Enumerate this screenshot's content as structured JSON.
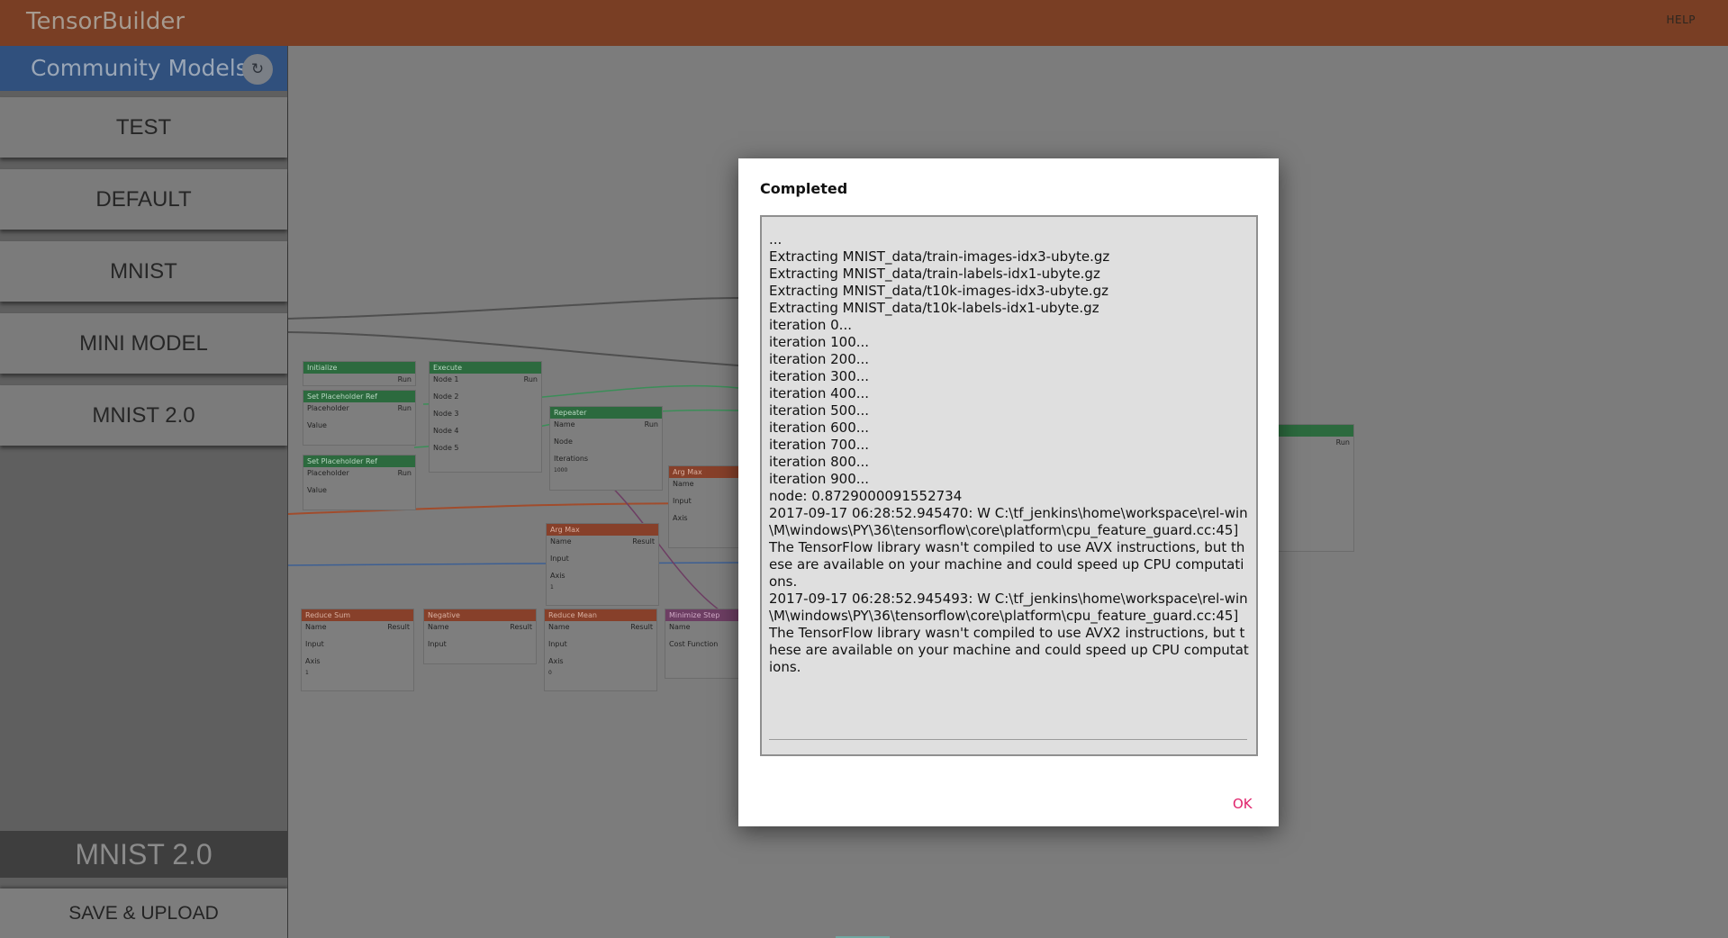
{
  "app": {
    "title": "TensorBuilder",
    "help_label": "HELP"
  },
  "sidebar": {
    "title": "Community Models",
    "refresh_icon": "↻",
    "models": [
      "TEST",
      "DEFAULT",
      "MNIST",
      "MINI MODEL",
      "MNIST 2.0"
    ],
    "current_model": "MNIST 2.0",
    "save_label": "SAVE & UPLOAD"
  },
  "canvas": {
    "nodes": {
      "initialize": {
        "title": "Initialize",
        "run": "Run"
      },
      "set_ph_1": {
        "title": "Set Placeholder Ref",
        "placeholder": "Placeholder",
        "run": "Run",
        "value": "Value"
      },
      "set_ph_2": {
        "title": "Set Placeholder Ref",
        "placeholder": "Placeholder",
        "run": "Run",
        "value": "Value"
      },
      "execute": {
        "title": "Execute",
        "run": "Run",
        "node1": "Node 1",
        "node2": "Node 2",
        "node3": "Node 3",
        "node4": "Node 4",
        "node5": "Node 5"
      },
      "repeater": {
        "title": "Repeater",
        "name": "Name",
        "run": "Run",
        "node": "Node",
        "iterations": "Iterations",
        "iterations_value": "1000"
      },
      "argmax_1": {
        "title": "Arg Max",
        "name": "Name",
        "input": "Input",
        "axis": "Axis"
      },
      "argmax_2": {
        "title": "Arg Max",
        "name": "Name",
        "result": "Result",
        "input": "Input",
        "axis": "Axis",
        "axis_value": "1"
      },
      "reduce_sum": {
        "title": "Reduce Sum",
        "name": "Name",
        "result": "Result",
        "input": "Input",
        "axis": "Axis",
        "axis_value": "1"
      },
      "negative": {
        "title": "Negative",
        "name": "Name",
        "result": "Result",
        "input": "Input"
      },
      "reduce_mean": {
        "title": "Reduce Mean",
        "name": "Name",
        "result": "Result",
        "input": "Input",
        "axis": "Axis",
        "axis_value": "0"
      },
      "minimize_step": {
        "title": "Minimize Step",
        "name": "Name",
        "cost": "Cost Function"
      },
      "right_node": {
        "run": "Run"
      }
    }
  },
  "dialog": {
    "title": "Completed",
    "log_lines": [
      "...",
      "Extracting MNIST_data/train-images-idx3-ubyte.gz",
      "Extracting MNIST_data/train-labels-idx1-ubyte.gz",
      "Extracting MNIST_data/t10k-images-idx3-ubyte.gz",
      "Extracting MNIST_data/t10k-labels-idx1-ubyte.gz",
      "iteration 0...",
      "iteration 100...",
      "iteration 200...",
      "iteration 300...",
      "iteration 400...",
      "iteration 500...",
      "iteration 600...",
      "iteration 700...",
      "iteration 800...",
      "iteration 900...",
      "node: 0.8729000091552734",
      "2017-09-17 06:28:52.945470: W C:\\tf_jenkins\\home\\workspace\\rel-win\\M\\windows\\PY\\36\\tensorflow\\core\\platform\\cpu_feature_guard.cc:45]",
      "The TensorFlow library wasn't compiled to use AVX instructions, but these are available on your machine and could speed up CPU computations.",
      "2017-09-17 06:28:52.945493: W C:\\tf_jenkins\\home\\workspace\\rel-win\\M\\windows\\PY\\36\\tensorflow\\core\\platform\\cpu_feature_guard.cc:45]",
      "The TensorFlow library wasn't compiled to use AVX2 instructions, but these are available on your machine and could speed up CPU computations."
    ],
    "ok_label": "OK"
  },
  "colors": {
    "topbar": "#793e24",
    "sidebar_header": "#30507d",
    "ok": "#e0226b",
    "node_green": "#2c6a3e",
    "node_orange": "#87402a"
  }
}
